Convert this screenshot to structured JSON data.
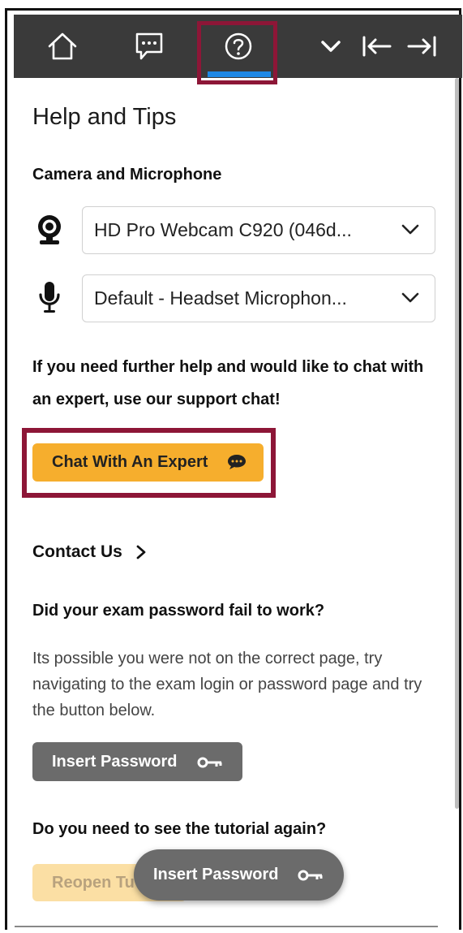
{
  "header": {
    "icons": [
      "home-icon",
      "chat-icon",
      "help-icon",
      "chevron-down-icon",
      "collapse-left-icon",
      "expand-right-icon"
    ],
    "active_tab_color": "#1e88e5",
    "background": "#3a3a3a"
  },
  "panel": {
    "title": "Help and Tips",
    "camera_section": "Camera and Microphone",
    "camera_value": "HD Pro Webcam C920 (046d...",
    "microphone_value": "Default - Headset Microphon...",
    "help_text": "If you need further help and would like to chat with an expert, use our support chat!",
    "chat_button": "Chat With An Expert",
    "contact_link": "Contact Us",
    "password_heading": "Did your exam password fail to work?",
    "password_text": "Its possible you were not on the correct page, try navigating to the exam login or password page and try the button below.",
    "insert_password_button": "Insert Password",
    "tutorial_heading": "Do you need to see the tutorial again?",
    "reopen_button": "Reopen Tu",
    "floating_button": "Insert Password"
  },
  "colors": {
    "highlight": "#8d1637",
    "chat_button": "#f6ae2d",
    "gray_button": "#6b6b6b"
  }
}
